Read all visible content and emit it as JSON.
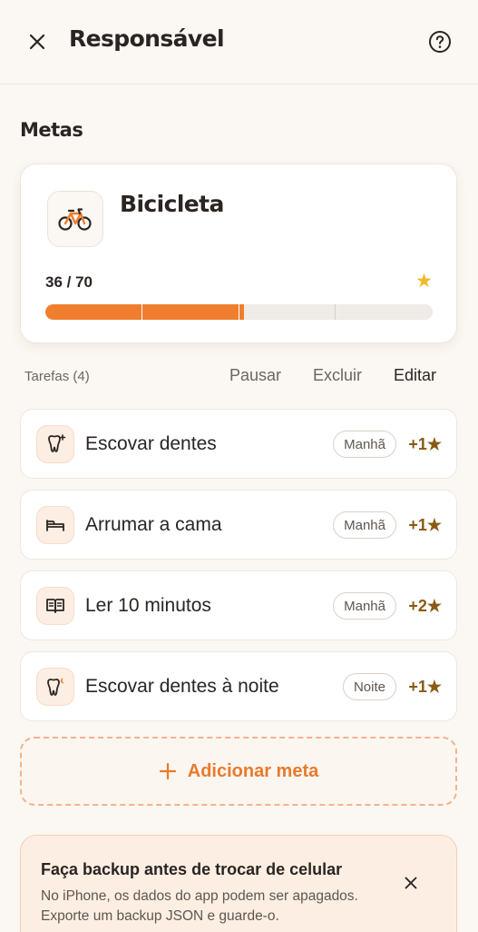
{
  "header": {
    "title": "Responsável",
    "close_icon": "close-icon",
    "help_icon": "help-circle-icon"
  },
  "goals_section": {
    "title": "Metas"
  },
  "goal": {
    "name": "Bicicleta",
    "icon": "bicycle-icon",
    "progress_text": "36 / 70",
    "current": 36,
    "target": 70,
    "progress_fraction": 0.514,
    "star_icon": "star-icon"
  },
  "tasks_bar": {
    "label": "Tarefas (4)",
    "pause": "Pausar",
    "delete": "Excluir",
    "edit": "Editar"
  },
  "tasks": [
    {
      "name": "Escovar dentes",
      "period": "Manhã",
      "points": "+1★",
      "icon": "tooth-sparkle-icon"
    },
    {
      "name": "Arrumar a cama",
      "period": "Manhã",
      "points": "+1★",
      "icon": "bed-icon"
    },
    {
      "name": "Ler 10 minutos",
      "period": "Manhã",
      "points": "+2★",
      "icon": "book-icon"
    },
    {
      "name": "Escovar dentes à noite",
      "period": "Noite",
      "points": "+1★",
      "icon": "tooth-night-icon"
    }
  ],
  "add_goal": {
    "label": "Adicionar meta",
    "icon": "plus-icon"
  },
  "backup_banner": {
    "title": "Faça backup antes de trocar de celular",
    "body": "No iPhone, os dados do app podem ser apagados. Exporte um backup JSON e guarde-o.",
    "close_icon": "close-icon"
  },
  "colors": {
    "accent": "#ef7e2f",
    "star": "#f2b72c",
    "points": "#8a5a14",
    "background": "#fbf7f2",
    "banner_bg": "#fdeee3"
  }
}
